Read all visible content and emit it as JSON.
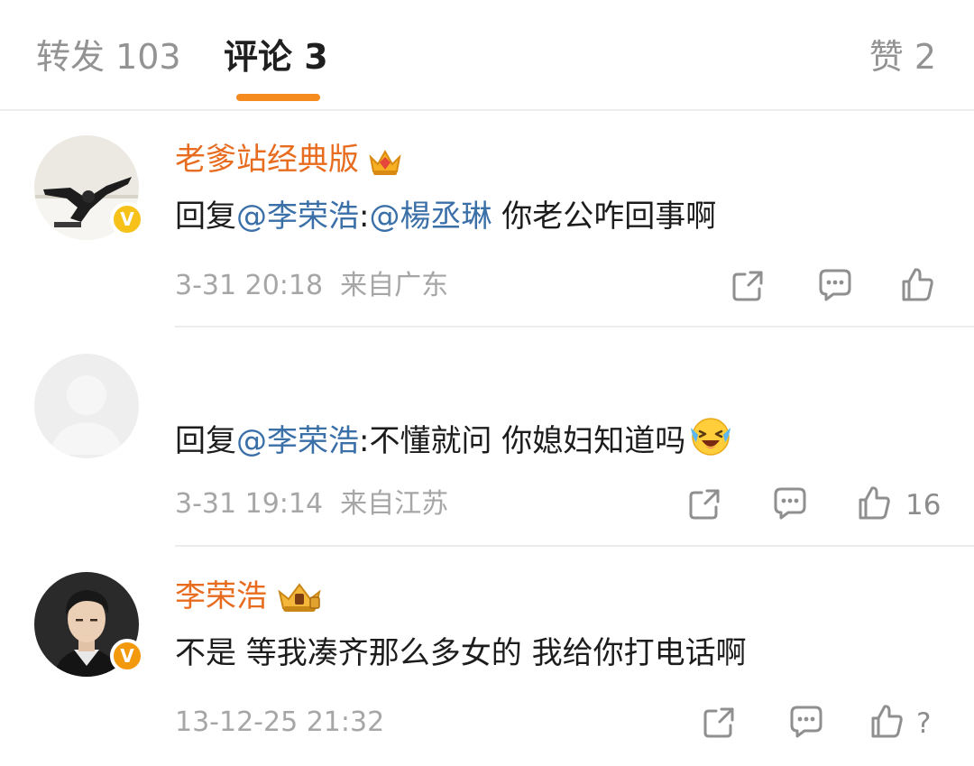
{
  "tabs": [
    {
      "label": "转发 103",
      "active": false
    },
    {
      "label": "评论 3",
      "active": true
    },
    {
      "label": "赞 2",
      "active": false
    }
  ],
  "colors": {
    "accent": "#f58a1f",
    "username": "#e86c1f",
    "mention": "#3a6fa8",
    "verified_badge": "#f6c21a",
    "meta_text": "#a6a6a6"
  },
  "comments": [
    {
      "username": "老爹站经典版",
      "reply_prefix": "回复",
      "mention1": "@李荣浩",
      "sep": ":",
      "mention2": "@楊丞琳",
      "text": " 你老公咋回事啊",
      "time": "3-31 20:18",
      "location": "来自广东",
      "like_count": "",
      "verified": true,
      "member_icon": "crown-icon"
    },
    {
      "username": "",
      "reply_prefix": "回复",
      "mention1": "@李荣浩",
      "text": ":不懂就问 你媳妇知道吗",
      "time": "3-31 19:14",
      "location": "来自江苏",
      "like_count": "16",
      "verified": false,
      "emoji": "laugh-cry-emoji"
    },
    {
      "username": "李荣浩",
      "text": "不是 等我凑齐那么多女的 我给你打电话啊",
      "time": "13-12-25 21:32",
      "location": "",
      "like_count": "?",
      "verified": true,
      "member_icon": "crown-badge-icon"
    }
  ],
  "icons": {
    "share": "share-icon",
    "comment": "comment-icon",
    "like": "thumbs-up-icon"
  }
}
